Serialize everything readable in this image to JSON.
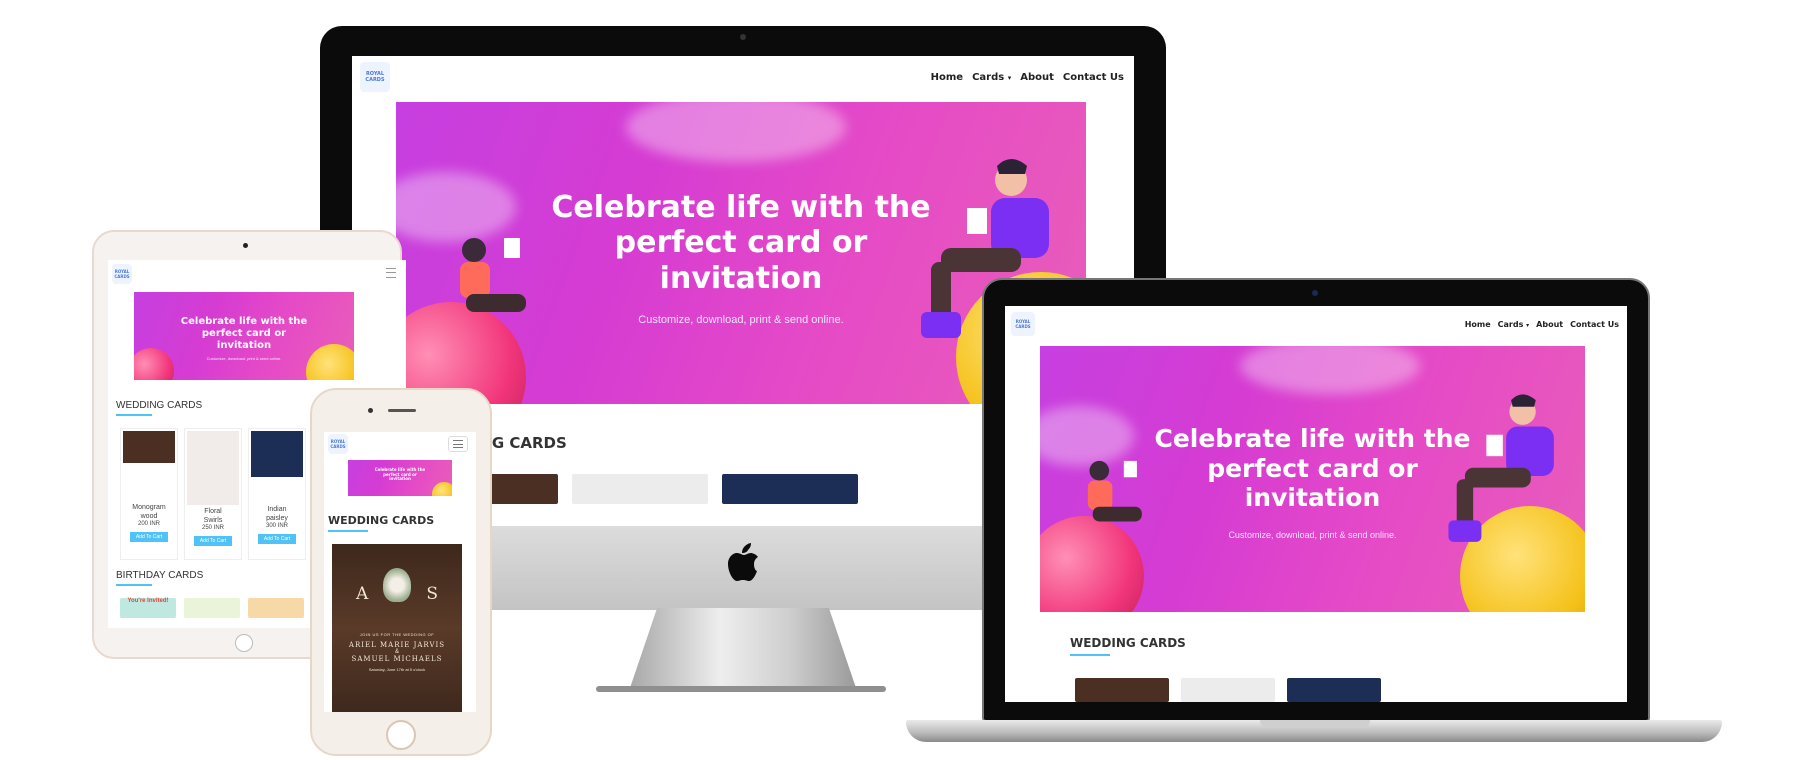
{
  "site": {
    "logo_text": "ROYAL CARDS",
    "nav": {
      "home": "Home",
      "cards": "Cards",
      "about": "About",
      "contact": "Contact Us"
    },
    "hero": {
      "title_line1": "Celebrate life with the",
      "title_line2": "perfect card or",
      "title_line3": "invitation",
      "subtitle": "Customize, download, print & send online."
    },
    "sections": {
      "wedding": "WEDDING CARDS",
      "birthday": "BIRTHDAY CARDS"
    },
    "wedding_cards": [
      {
        "name_line1": "Monogram",
        "name_line2": "wood",
        "price": "200 INR",
        "button": "Add To Cart"
      },
      {
        "name_line1": "Floral",
        "name_line2": "Swirls",
        "price": "250 INR",
        "button": "Add To Cart"
      },
      {
        "name_line1": "Indian",
        "name_line2": "paisley",
        "price": "300 INR",
        "button": "Add To Cart"
      }
    ],
    "phone_card": {
      "initial_left": "A",
      "initial_right": "S",
      "line1": "JOIN US FOR THE WEDDING OF",
      "line2": "ARIEL MARIE JARVIS",
      "line3": "&",
      "line4": "SAMUEL MICHAELS",
      "line5": "Saturday, June 17th at 5 o'clock"
    },
    "birthday_thumb_text": "You're Invited!"
  },
  "colors": {
    "accent": "#4fc3f7",
    "hero_start": "#c63fe0",
    "hero_end": "#e85eb8",
    "button": "#4fc3f7"
  }
}
